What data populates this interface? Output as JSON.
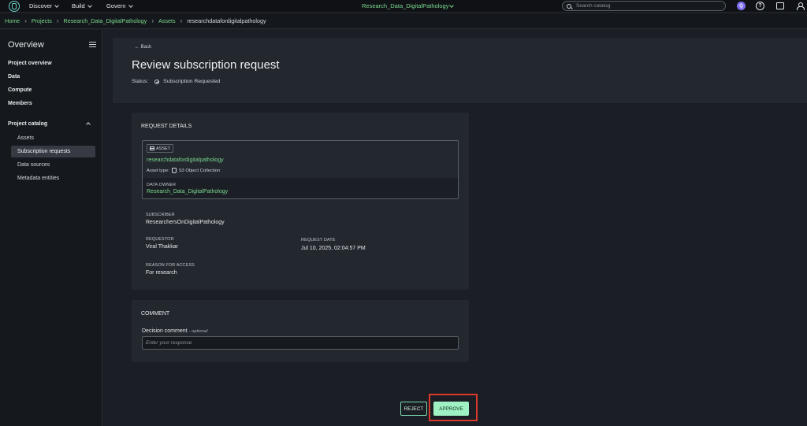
{
  "topnav": {
    "menus": [
      "Discover",
      "Build",
      "Govern"
    ],
    "project": "Research_Data_DigitalPathology",
    "search_placeholder": "Search catalog",
    "ai_label": "Q"
  },
  "breadcrumb": [
    "Home",
    "Projects",
    "Research_Data_DigitalPathology",
    "Assets",
    "researchdatafordigitalpathology"
  ],
  "sidebar": {
    "title": "Overview",
    "items": [
      "Project overview",
      "Data",
      "Compute",
      "Members"
    ],
    "catalog_title": "Project catalog",
    "catalog_items": [
      "Assets",
      "Subscription requests",
      "Data sources",
      "Metadata entities"
    ],
    "active": "Subscription requests"
  },
  "header": {
    "back": "Back",
    "title": "Review subscription request",
    "status_label": "Status:",
    "status_value": "Subscription Requested"
  },
  "request": {
    "section_title": "REQUEST DETAILS",
    "asset_badge": "ASSET",
    "asset_name": "researchdatafordigitalpathology",
    "asset_type_label": "Asset type:",
    "asset_type": "S3 Object Collection",
    "owner_label": "DATA OWNER",
    "owner": "Research_Data_DigitalPathology",
    "subscriber_label": "SUBSCRIBER",
    "subscriber": "ResearchersOnDigitalPathology",
    "requestor_label": "REQUESTOR",
    "requestor": "Viral Thakkar",
    "date_label": "REQUEST DATE",
    "date": "Jul 10, 2025, 02:04:57 PM",
    "reason_label": "REASON FOR ACCESS",
    "reason": "For research"
  },
  "comment": {
    "section_title": "COMMENT",
    "label": "Decision comment",
    "optional": "- optional",
    "placeholder": "Enter your response"
  },
  "actions": {
    "reject": "REJECT",
    "approve": "APPROVE"
  },
  "colors": {
    "accent_green": "#7bd88f",
    "approve_bg": "#9ff0c2",
    "highlight_red": "#d93a2e",
    "background": "#1b1e24",
    "panel": "#23272e"
  }
}
